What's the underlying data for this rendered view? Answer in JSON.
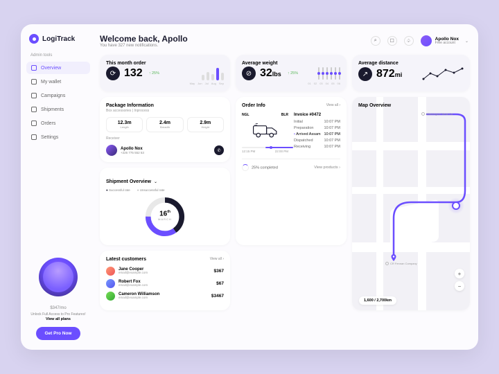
{
  "brand": "LogiTrack",
  "nav": {
    "section": "Admin tools",
    "items": [
      "Overview",
      "My wallet",
      "Campaigns",
      "Shipments",
      "Orders",
      "Settings"
    ]
  },
  "pro": {
    "price": "$347",
    "per": "/mo",
    "subtitle": "Unlock Full Access to Pro Features!",
    "plans": "View all plans",
    "cta": "Get Pro Now"
  },
  "header": {
    "welcome": "Welcome back, Apollo",
    "sub": "You have 327 new notifications.",
    "user_name": "Apollo Nox",
    "user_type": "Free account"
  },
  "metrics": {
    "order": {
      "title": "This month order",
      "value": "132",
      "delta": "↑ 25%",
      "axis": [
        "May",
        "Jun",
        "Jul",
        "Aug",
        "Sep"
      ]
    },
    "weight": {
      "title": "Average weight",
      "value": "32",
      "unit": "lbs",
      "delta": "↑ 25%",
      "axis": [
        "01",
        "02",
        "03",
        "04",
        "05",
        "06"
      ]
    },
    "distance": {
      "title": "Average distance",
      "value": "872",
      "unit": "mi"
    }
  },
  "package": {
    "title": "Package Information",
    "sub": "Box accessories | Inprocess",
    "stats": [
      {
        "v": "12.3m",
        "l": "Length"
      },
      {
        "v": "2.4m",
        "l": "Breadth"
      },
      {
        "v": "2.9m",
        "l": "Height"
      }
    ],
    "receiver_label": "Receiver",
    "receiver_name": "Apollo Nox",
    "receiver_phone": "+226 775 552 53"
  },
  "order": {
    "title": "Order Info",
    "viewall": "View all ›",
    "from": "NGL",
    "to": "BLR",
    "time_from": "12:15 PM",
    "time_to": "22:00 PM",
    "invoice": "Invoice #0472",
    "steps": [
      {
        "k": "Initial",
        "v": "10:07 PM"
      },
      {
        "k": "Preparation",
        "v": "10:07 PM"
      },
      {
        "k": "Arrived Assam",
        "v": "10:07 PM",
        "act": true
      },
      {
        "k": "Dispatched",
        "v": "10:07 PM"
      },
      {
        "k": "Receiving",
        "v": "10:07 PM"
      }
    ],
    "progress": "25% completed",
    "view_products": "View products ›"
  },
  "shipment": {
    "title": "Shipment Overview",
    "leg_ok": "Successful rate",
    "leg_bad": "Unsuccessful rate",
    "day": "16",
    "suffix": "th",
    "month": "MARCH"
  },
  "customers": {
    "title": "Latest customers",
    "viewall": "View all ›",
    "rows": [
      {
        "n": "Jane Cooper",
        "e": "email@example.com",
        "a": "$367"
      },
      {
        "n": "Robert Fox",
        "e": "email@example.com",
        "a": "$67"
      },
      {
        "n": "Cameron Williamson",
        "e": "email@example.com",
        "a": "$3467"
      }
    ]
  },
  "map": {
    "title": "Map Overview",
    "scale": "1,600 / 2,700km",
    "poi1": "Washington Metal Co",
    "poi2": "CR Fennan Company"
  }
}
